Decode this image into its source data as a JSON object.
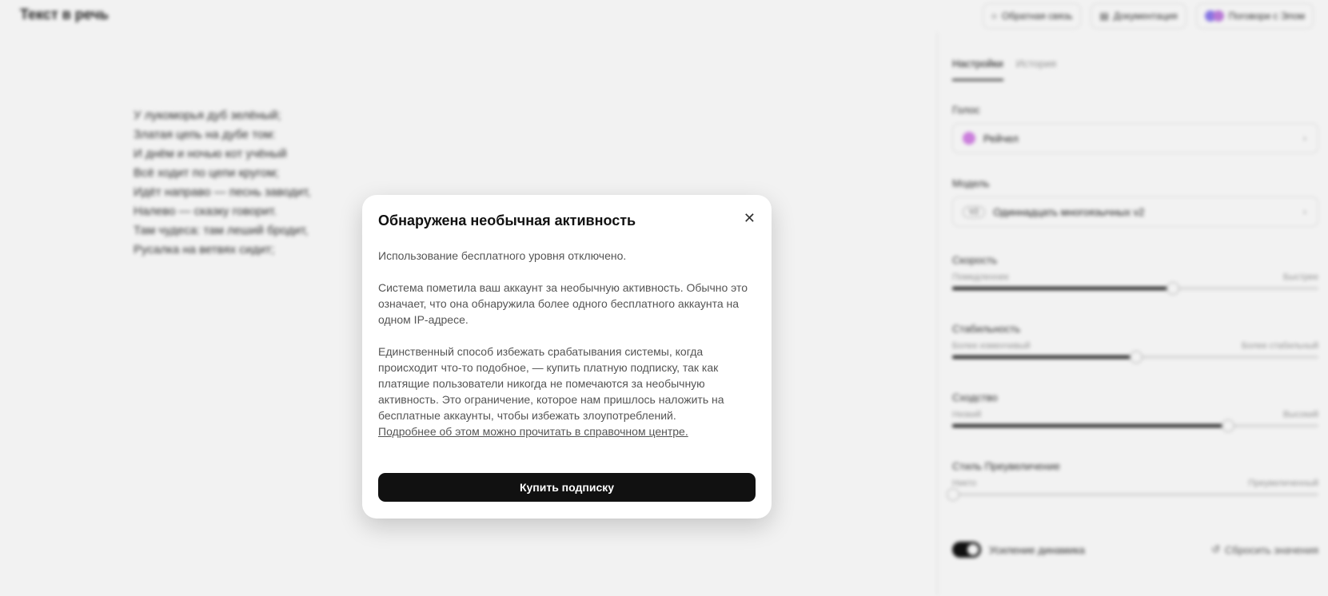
{
  "app": {
    "title": "Текст в речь",
    "header": {
      "feedback_label": "Обратная связь",
      "docs_label": "Документация",
      "talk_label": "Поговори с Элом"
    },
    "editor_lines": [
      "У лукоморья дуб зелёный;",
      "Златая цепь на дубе том:",
      "И днём и ночью кот учёный",
      "Всё ходит по цепи кругом;",
      "Идёт направо — песнь заводит,",
      "Налево — сказку говорит.",
      "Там чудеса: там леший бродит,",
      "Русалка на ветвях сидит;"
    ],
    "sidebar": {
      "tabs": [
        {
          "label": "Настройки",
          "active": true
        },
        {
          "label": "История",
          "active": false
        }
      ],
      "voice": {
        "label": "Голос",
        "value": "Рейчел"
      },
      "model": {
        "label": "Модель",
        "badge": "V2",
        "value": "Одиннадцать многоязычных v2"
      },
      "sliders": [
        {
          "title": "Скорость",
          "left": "Помедленнее",
          "right": "Быстрее",
          "value": 0.6
        },
        {
          "title": "Стабильность",
          "left": "Более изменчивый",
          "right": "Более стабильный",
          "value": 0.5
        },
        {
          "title": "Сходство",
          "left": "Низкий",
          "right": "Высокий",
          "value": 0.75
        },
        {
          "title": "Стиль Преувеличение",
          "left": "Никто",
          "right": "Преувеличенный",
          "value": 0.0
        }
      ],
      "speaker_boost_label": "Усиление динамика",
      "reset_label": "Сбросить значения"
    }
  },
  "modal": {
    "title": "Обнаружена необычная активность",
    "p1": "Использование бесплатного уровня отключено.",
    "p2": "Система пометила ваш аккаунт за необычную активность. Обычно это означает, что она обнаружила более одного бесплатного аккаунта на одном IP-адресе.",
    "p3": "Единственный способ избежать срабатывания системы, когда происходит что-то подобное, — купить платную подписку, так как платящие пользователи никогда не помечаются за необычную активность. Это ограничение, которое нам пришлось наложить на бесплатные аккаунты, чтобы избежать злоупотреблений.",
    "link": "Подробнее об этом можно прочитать в справочном центре.",
    "button": "Купить подписку",
    "close_glyph": "✕"
  },
  "colors": {
    "primary": "#111111",
    "voice_dot": "#d685e8"
  }
}
